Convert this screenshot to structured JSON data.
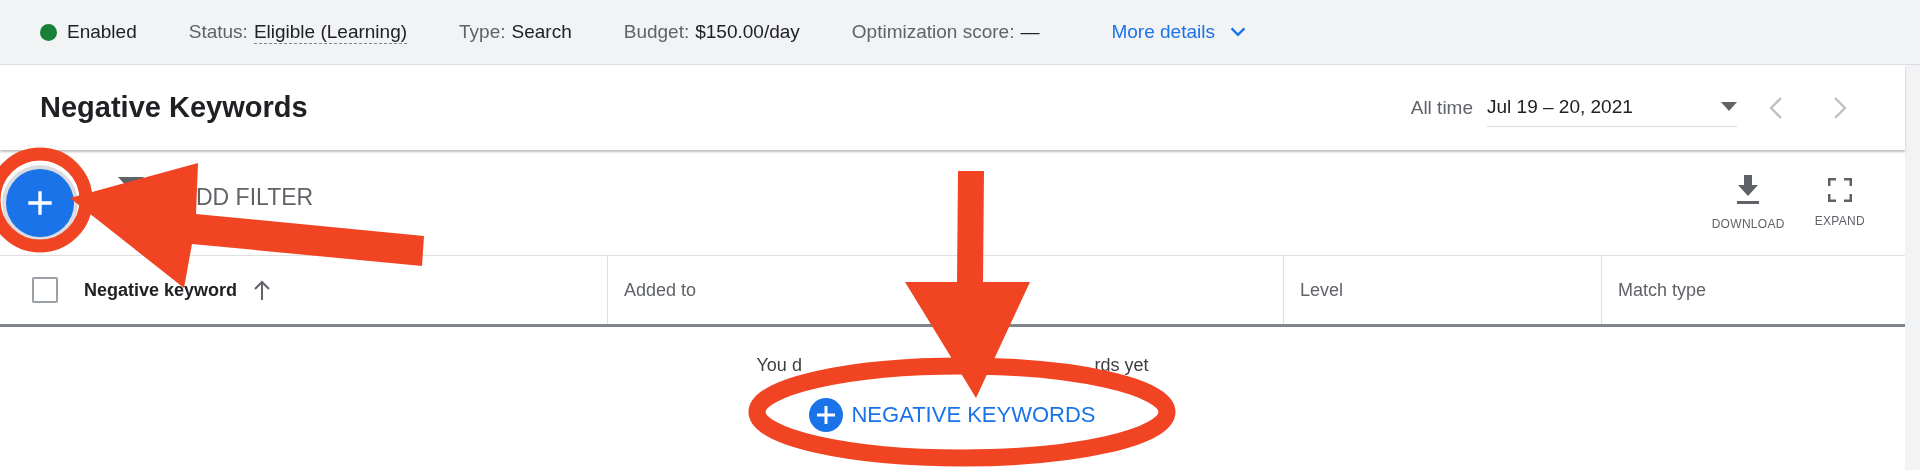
{
  "status_bar": {
    "items": [
      {
        "kind": "state",
        "text": "Enabled"
      },
      {
        "kind": "field",
        "label": "Status:",
        "value": "Eligible (Learning)",
        "underlined": true
      },
      {
        "kind": "field",
        "label": "Type:",
        "value": "Search",
        "underlined": false
      },
      {
        "kind": "field",
        "label": "Budget:",
        "value": "$150.00/day",
        "underlined": false
      },
      {
        "kind": "field",
        "label": "Optimization score:",
        "value": "—",
        "underlined": false
      },
      {
        "kind": "link",
        "text": "More details"
      }
    ]
  },
  "header": {
    "title": "Negative Keywords",
    "date_label": "All time",
    "date_value": "Jul 19 – 20, 2021",
    "prev": {
      "disabled": true
    },
    "next": {
      "disabled": true
    }
  },
  "toolbar": {
    "filter": "DD FILTER",
    "actions": [
      {
        "kind": "download",
        "label": "DOWNLOAD"
      },
      {
        "kind": "expand",
        "label": "EXPAND"
      }
    ]
  },
  "table": {
    "select_all_checked": false,
    "columns": [
      {
        "label": "Negative keyword",
        "sorted": true
      },
      {
        "label": "Added to",
        "sorted": false
      },
      {
        "label": "Level",
        "sorted": false
      },
      {
        "label": "Match type",
        "sorted": false
      }
    ]
  },
  "empty_state": {
    "message_parts": [
      "You d",
      "rds yet"
    ],
    "button": "NEGATIVE KEYWORDS"
  }
}
